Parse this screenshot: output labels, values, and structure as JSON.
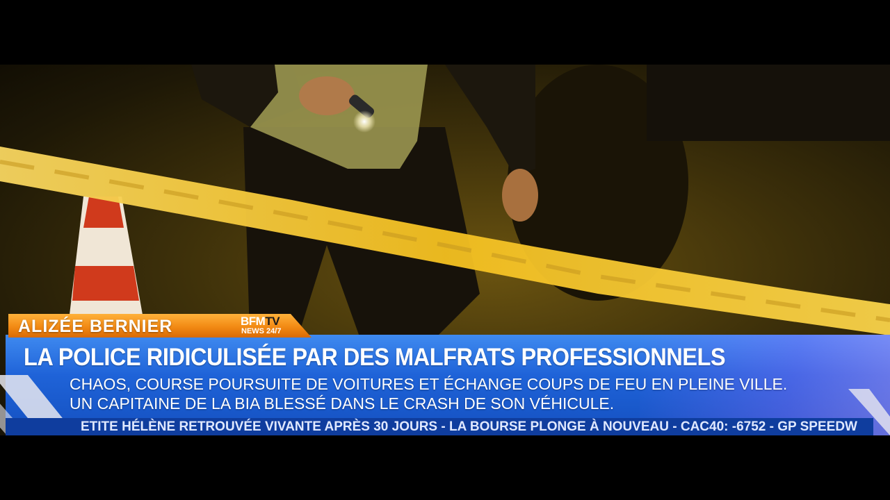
{
  "lower_third": {
    "reporter_name": "ALIZÉE BERNIER",
    "channel_logo_main": "BFM",
    "channel_logo_tv": "TV",
    "channel_logo_sub": "NEWS 24/7",
    "headline": "LA POLICE RIDICULISÉE PAR DES MALFRATS  PROFESSIONNELS",
    "subline_1": "CHAOS, COURSE POURSUITE DE VOITURES ET ÉCHANGE COUPS DE FEU EN PLEINE VILLE.",
    "subline_2": "UN CAPITAINE DE LA BIA BLESSÉ DANS LE CRASH DE SON VÉHICULE.",
    "ticker": "ETITE HÉLÈNE RETROUVÉE VIVANTE APRÈS 30 JOURS  -  LA BOURSE PLONGE À NOUVEAU  -  CAC40: -6752  -  GP SPEEDW"
  },
  "colors": {
    "name_tab": "#f28a14",
    "panel_blue": "#1f63d8",
    "ticker_blue": "#0f3d9e",
    "tape_yellow": "#f4c020"
  }
}
